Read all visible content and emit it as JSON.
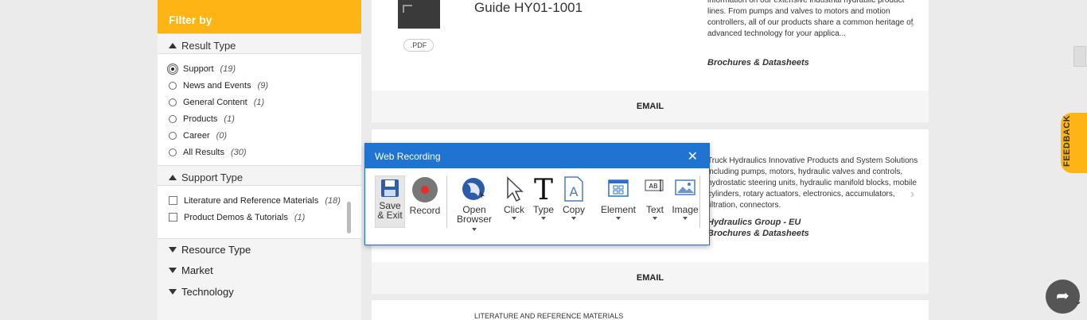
{
  "sidebar": {
    "filter_header": "Filter by",
    "result_type": {
      "title": "Result Type",
      "options": [
        {
          "label": "Support",
          "count": "(19)",
          "checked": true
        },
        {
          "label": "News and Events",
          "count": "(9)",
          "checked": false
        },
        {
          "label": "General Content",
          "count": "(1)",
          "checked": false
        },
        {
          "label": "Products",
          "count": "(1)",
          "checked": false
        },
        {
          "label": "Career",
          "count": "(0)",
          "checked": false
        },
        {
          "label": "All Results",
          "count": "(30)",
          "checked": false
        }
      ]
    },
    "support_type": {
      "title": "Support Type",
      "options": [
        {
          "label": "Literature and Reference Materials",
          "count": "(18)"
        },
        {
          "label": "Product Demos & Tutorials",
          "count": "(1)"
        }
      ]
    },
    "collapsed": [
      "Resource Type",
      "Market",
      "Technology"
    ]
  },
  "cards": [
    {
      "title": "Guide HY01-1001",
      "badge": ".PDF",
      "description": "information on our extensive industrial hydraulic product lines. From pumps and valves to motors and motion controllers, all of our products share a common heritage of advanced technology for your applica...",
      "category": "Brochures & Datasheets",
      "email": "EMAIL"
    },
    {
      "description": "Truck Hydraulics Innovative Products and System Solutions including pumps, motors, hydraulic valves and controls, hydrostatic steering units, hydraulic manifold blocks, mobile cylinders, rotary actuators, electronics, accumulators, filtration, connectors.",
      "group": "Hydraulics Group - EU",
      "category": "Brochures & Datasheets",
      "email": "EMAIL"
    },
    {
      "label": "LITERATURE AND REFERENCE MATERIALS"
    }
  ],
  "feedback": "FEEDBACK",
  "dialog": {
    "title": "Web Recording",
    "tools": [
      {
        "icon": "save-icon",
        "label1": "Save",
        "label2": "& Exit"
      },
      {
        "icon": "record-icon",
        "label1": "Record"
      },
      {
        "icon": "open-browser-icon",
        "label1": "Open",
        "label2": "Browser"
      },
      {
        "icon": "click-icon",
        "label1": "Click"
      },
      {
        "icon": "type-icon",
        "label1": "Type"
      },
      {
        "icon": "copy-icon",
        "label1": "Copy"
      },
      {
        "icon": "element-icon",
        "label1": "Element"
      },
      {
        "icon": "text-icon",
        "label1": "Text"
      },
      {
        "icon": "image-icon",
        "label1": "Image"
      }
    ]
  }
}
